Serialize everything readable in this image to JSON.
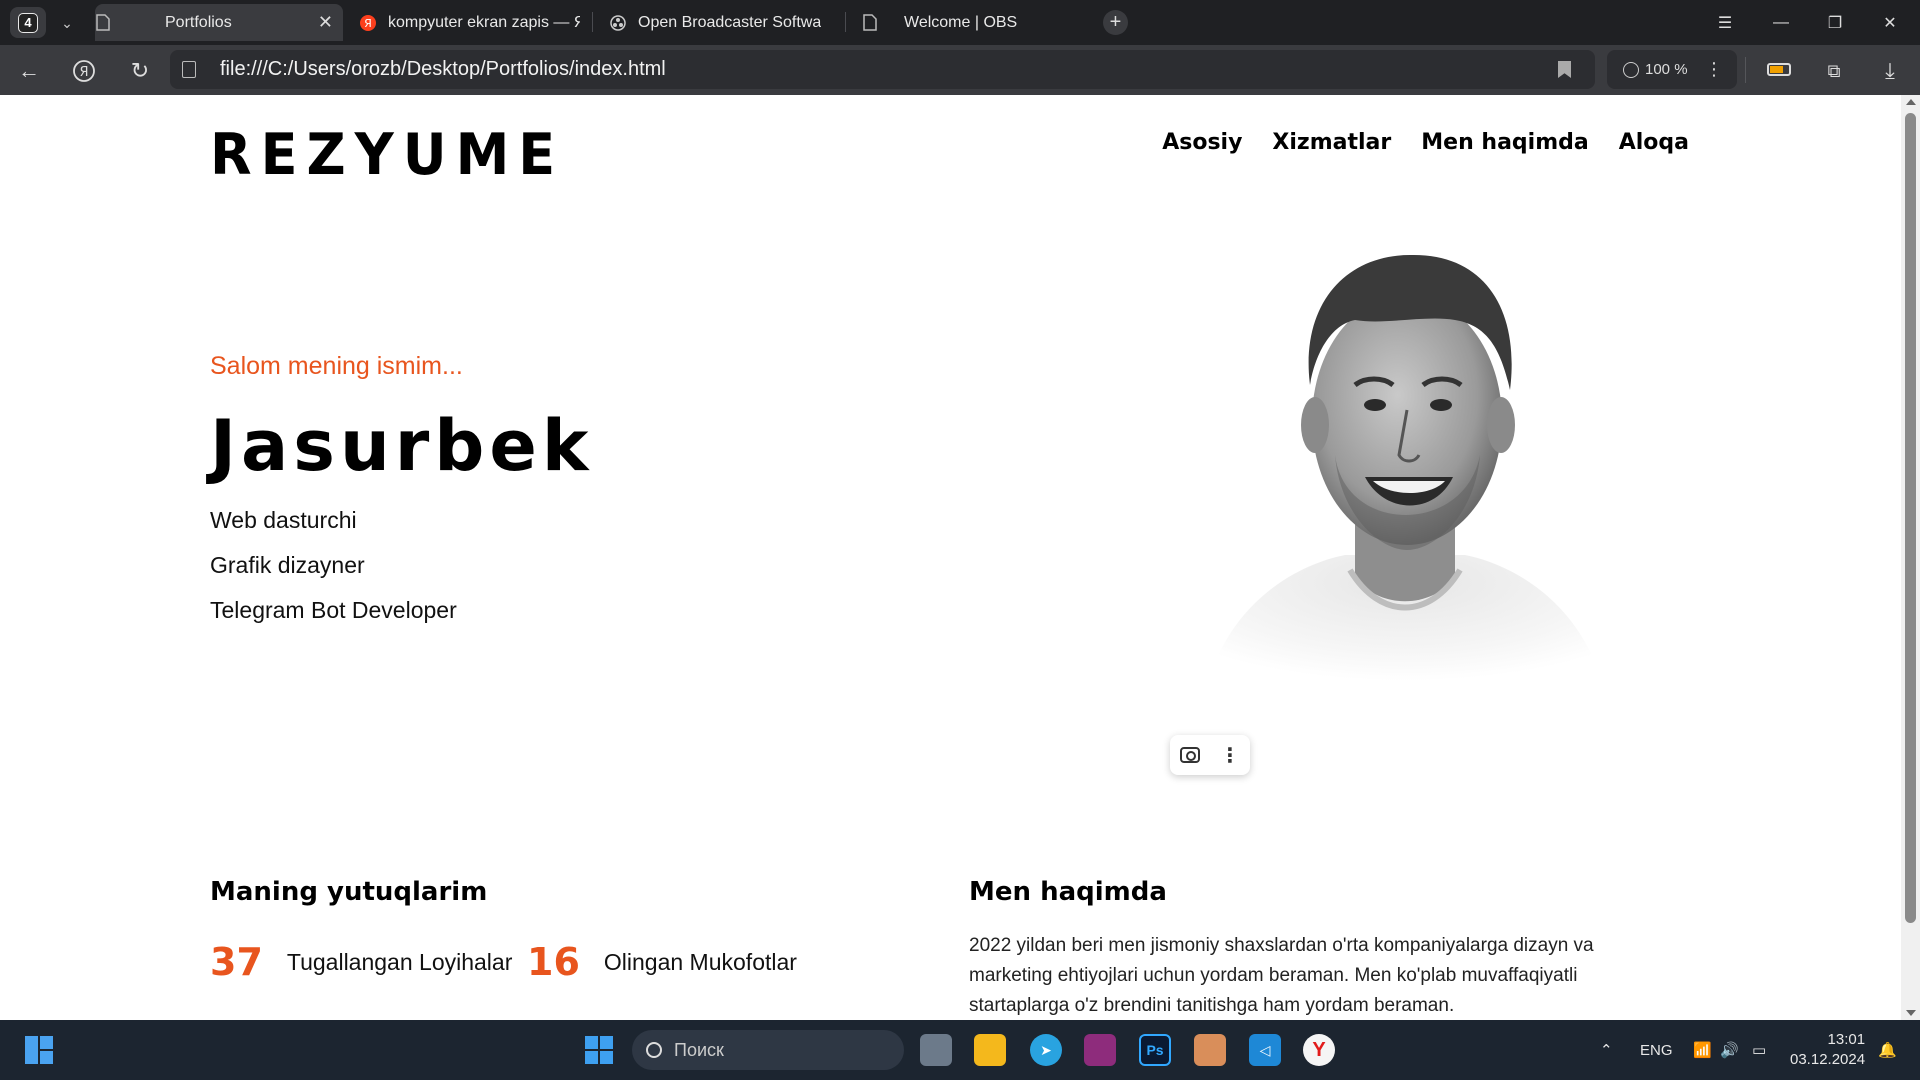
{
  "browser": {
    "tab_count": "4",
    "tabs": [
      {
        "title": "Portfolios",
        "active": true
      },
      {
        "title": "kompyuter ekran zapis — Я",
        "active": false
      },
      {
        "title": "Open Broadcaster Softwa",
        "active": false
      },
      {
        "title": "Welcome | OBS",
        "active": false
      }
    ],
    "url": "file:///C:/Users/orozb/Desktop/Portfolios/index.html",
    "zoom": "100 %"
  },
  "page": {
    "logo": "REZYUME",
    "nav": [
      "Asosiy",
      "Xizmatlar",
      "Men haqimda",
      "Aloqa"
    ],
    "greeting": "Salom mening ismim...",
    "name": "Jasurbek",
    "roles": [
      "Web dasturchi",
      "Grafik dizayner",
      "Telegram Bot Developer"
    ],
    "achievements_title": "Maning yutuqlarim",
    "stats": [
      {
        "number": "37",
        "label": "Tugallangan Loyihalar"
      },
      {
        "number": "16",
        "label": "Olingan Mukofotlar"
      }
    ],
    "about_title": "Men haqimda",
    "about_text": "2022 yildan beri men jismoniy shaxslardan o'rta kompaniyalarga dizayn va marketing ehtiyojlari uchun yordam beraman. Men ko'plab muvaffaqiyatli startaplarga o'z brendini tanitishga ham yordam beraman.",
    "accent_color": "#e8551e"
  },
  "taskbar": {
    "search_placeholder": "Поиск",
    "language": "ENG",
    "time": "13:01",
    "date": "03.12.2024"
  }
}
